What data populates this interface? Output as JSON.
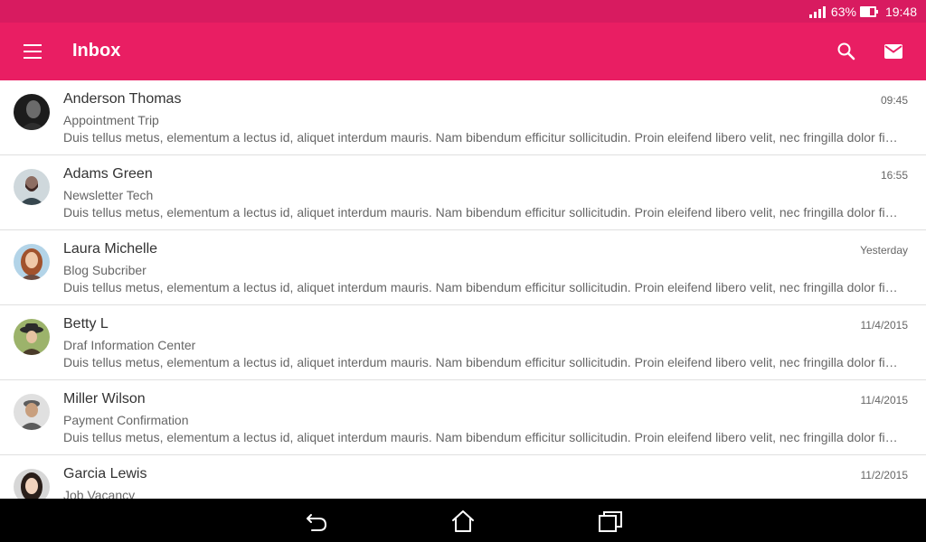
{
  "status_bar": {
    "battery": "63%",
    "time": "19:48",
    "battery_level": 0.63,
    "signal_bars": 4
  },
  "app_bar": {
    "title": "Inbox",
    "icons": [
      "menu-icon",
      "search-icon",
      "mail-icon"
    ]
  },
  "colors": {
    "primary": "#e91e63",
    "primary_dark": "#d81b60",
    "text_primary": "#333333",
    "text_secondary": "#666666"
  },
  "messages": [
    {
      "sender": "Anderson Thomas",
      "time": "09:45",
      "subject": "Appointment Trip",
      "preview": "Duis tellus metus, elementum a lectus id, aliquet interdum mauris. Nam bibendum efficitur sollicitudin. Proin eleifend libero velit, nec fringilla dolor finibus quis."
    },
    {
      "sender": "Adams Green",
      "time": "16:55",
      "subject": "Newsletter Tech",
      "preview": "Duis tellus metus, elementum a lectus id, aliquet interdum mauris. Nam bibendum efficitur sollicitudin. Proin eleifend libero velit, nec fringilla dolor finibus quis."
    },
    {
      "sender": "Laura Michelle",
      "time": "Yesterday",
      "subject": "Blog Subcriber",
      "preview": "Duis tellus metus, elementum a lectus id, aliquet interdum mauris. Nam bibendum efficitur sollicitudin. Proin eleifend libero velit, nec fringilla dolor finibus quis."
    },
    {
      "sender": "Betty L",
      "time": "11/4/2015",
      "subject": "Draf Information Center",
      "preview": "Duis tellus metus, elementum a lectus id, aliquet interdum mauris. Nam bibendum efficitur sollicitudin. Proin eleifend libero velit, nec fringilla dolor finibus quis."
    },
    {
      "sender": "Miller Wilson",
      "time": "11/4/2015",
      "subject": "Payment Confirmation",
      "preview": "Duis tellus metus, elementum a lectus id, aliquet interdum mauris. Nam bibendum efficitur sollicitudin. Proin eleifend libero velit, nec fringilla dolor finibus quis."
    },
    {
      "sender": "Garcia Lewis",
      "time": "11/2/2015",
      "subject": "Job Vacancy",
      "preview": ""
    }
  ],
  "nav_bar": {
    "icons": [
      "back-icon",
      "home-icon",
      "recents-icon"
    ]
  }
}
